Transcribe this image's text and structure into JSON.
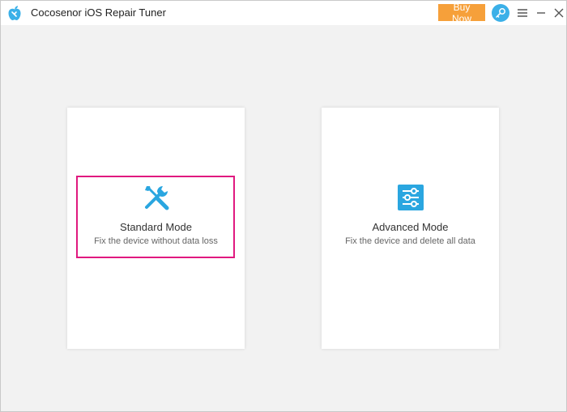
{
  "app": {
    "title": "Cocosenor iOS Repair Tuner",
    "accent": "#3bb0e8",
    "buy_color": "#f6a03a",
    "highlight_color": "#e0197f"
  },
  "titlebar": {
    "buy_label": "Buy Now",
    "icons": [
      "apple-logo-icon",
      "key-icon",
      "menu-icon",
      "minimize-icon",
      "close-icon"
    ]
  },
  "modes": [
    {
      "title": "Standard Mode",
      "description": "Fix the device without data loss",
      "icon": "wrench-screwdriver-icon",
      "selected": true
    },
    {
      "title": "Advanced Mode",
      "description": "Fix the device and delete all data",
      "icon": "sliders-icon",
      "selected": false
    }
  ]
}
